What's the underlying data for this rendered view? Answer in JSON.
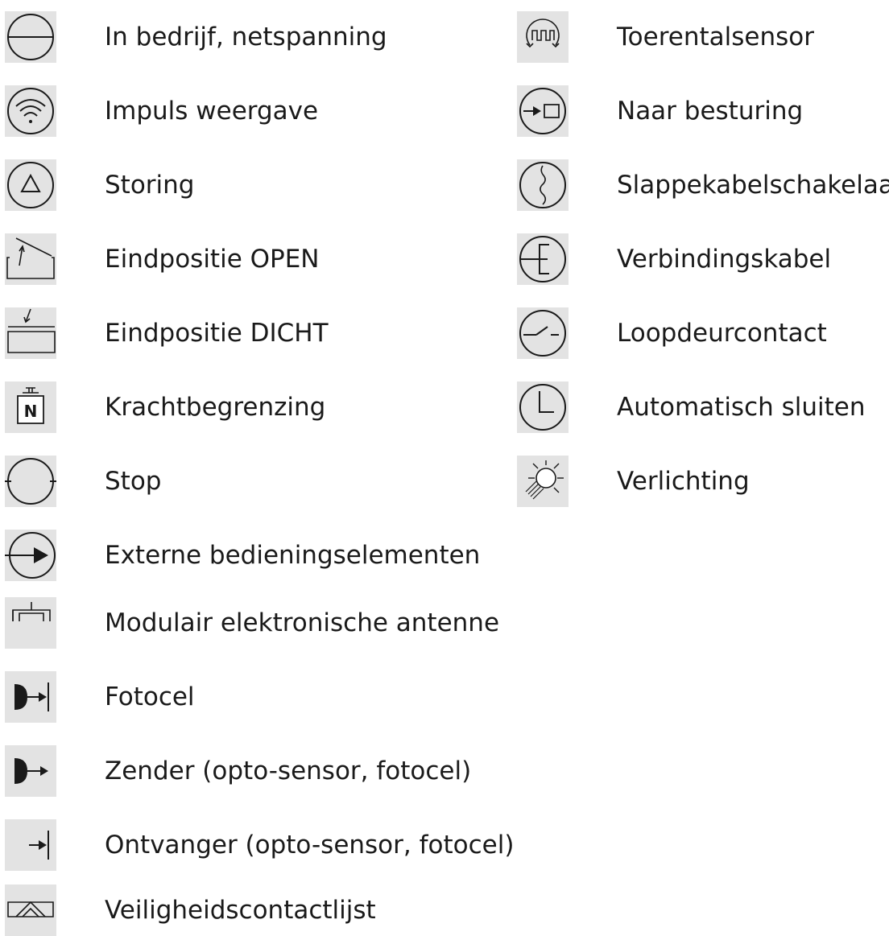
{
  "left_column": [
    {
      "icon": "power-circle-icon",
      "label": "In bedrijf, netspanning"
    },
    {
      "icon": "signal-waves-icon",
      "label": "Impuls weergave"
    },
    {
      "icon": "warning-triangle-icon",
      "label": "Storing"
    },
    {
      "icon": "end-position-open-icon",
      "label": "Eindpositie OPEN"
    },
    {
      "icon": "end-position-closed-icon",
      "label": "Eindpositie DICHT"
    },
    {
      "icon": "force-weight-icon",
      "label": "Krachtbegrenzing"
    },
    {
      "icon": "stop-circle-icon",
      "label": "Stop"
    },
    {
      "icon": "external-controls-icon",
      "label": "Externe bedieningselementen"
    },
    {
      "icon": "antenna-icon",
      "label": "Modulair elektronische antenne"
    },
    {
      "icon": "photocell-icon",
      "label": "Fotocel"
    },
    {
      "icon": "transmitter-icon",
      "label": "Zender (opto-sensor, fotocel)"
    },
    {
      "icon": "receiver-icon",
      "label": "Ontvanger (opto-sensor, fotocel)"
    },
    {
      "icon": "safety-edge-icon",
      "label": "Veiligheidscontactlijst"
    }
  ],
  "right_column": [
    {
      "icon": "speed-sensor-icon",
      "label": "Toerentalsensor"
    },
    {
      "icon": "to-control-icon",
      "label": "Naar besturing"
    },
    {
      "icon": "slack-cable-icon",
      "label": "Slappekabelschakelaar"
    },
    {
      "icon": "connection-cable-icon",
      "label": "Verbindingskabel"
    },
    {
      "icon": "wicket-door-contact-icon",
      "label": "Loopdeurcontact"
    },
    {
      "icon": "clock-icon",
      "label": "Automatisch sluiten"
    },
    {
      "icon": "lamp-icon",
      "label": "Verlichting"
    }
  ],
  "colors": {
    "icon_background": "#e3e3e3",
    "text": "#1a1a1a",
    "icon_stroke": "#1a1a1a"
  }
}
